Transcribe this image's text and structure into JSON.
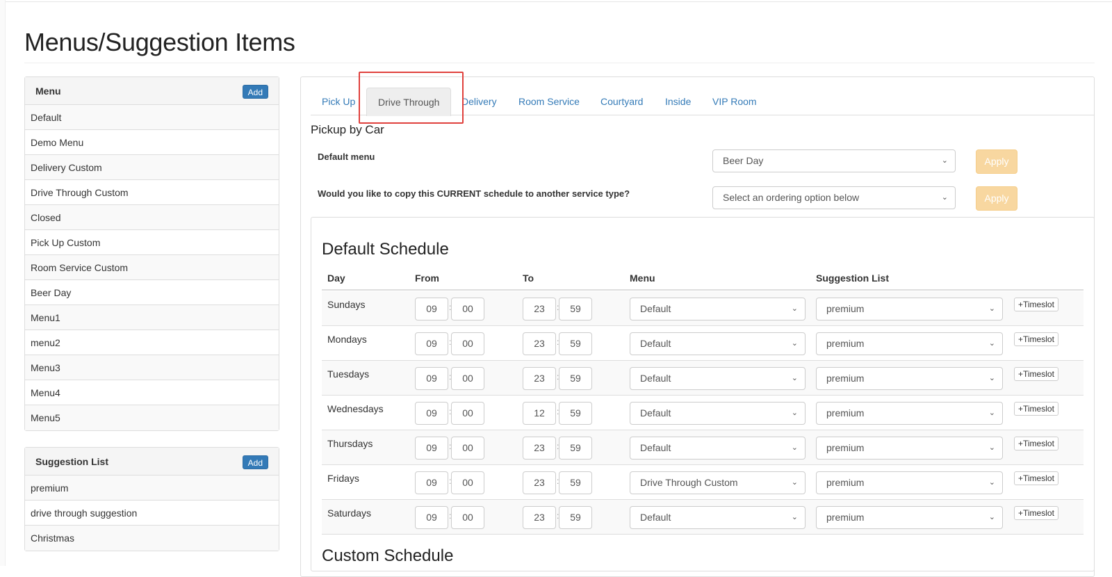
{
  "page": {
    "title": "Menus/Suggestion Items"
  },
  "menu_panel": {
    "title": "Menu",
    "add_label": "Add",
    "items": [
      "Default",
      "Demo Menu",
      "Delivery Custom",
      "Drive Through Custom",
      "Closed",
      "Pick Up Custom",
      "Room Service Custom",
      "Beer Day",
      "Menu1",
      "menu2",
      "Menu3",
      "Menu4",
      "Menu5"
    ]
  },
  "suggestion_panel": {
    "title": "Suggestion List",
    "add_label": "Add",
    "items": [
      "premium",
      "drive through suggestion",
      "Christmas"
    ]
  },
  "tabs": [
    "Pick Up",
    "Drive Through",
    "Delivery",
    "Room Service",
    "Courtyard",
    "Inside",
    "VIP Room"
  ],
  "active_tab": "Drive Through",
  "service": {
    "title": "Pickup by Car",
    "default_menu_label": "Default menu",
    "default_menu_value": "Beer Day",
    "copy_label": "Would you like to copy this CURRENT schedule to another service type?",
    "copy_placeholder": "Select an ordering option below",
    "apply_label": "Apply"
  },
  "schedule": {
    "title": "Default Schedule",
    "custom_title": "Custom Schedule",
    "headers": {
      "day": "Day",
      "from": "From",
      "to": "To",
      "menu": "Menu",
      "suggestion": "Suggestion List"
    },
    "timeslot_label": "+Timeslot",
    "rows": [
      {
        "day": "Sundays",
        "from_h": "09",
        "from_m": "00",
        "to_h": "23",
        "to_m": "59",
        "menu": "Default",
        "suggestion": "premium"
      },
      {
        "day": "Mondays",
        "from_h": "09",
        "from_m": "00",
        "to_h": "23",
        "to_m": "59",
        "menu": "Default",
        "suggestion": "premium"
      },
      {
        "day": "Tuesdays",
        "from_h": "09",
        "from_m": "00",
        "to_h": "23",
        "to_m": "59",
        "menu": "Default",
        "suggestion": "premium"
      },
      {
        "day": "Wednesdays",
        "from_h": "09",
        "from_m": "00",
        "to_h": "12",
        "to_m": "59",
        "menu": "Default",
        "suggestion": "premium"
      },
      {
        "day": "Thursdays",
        "from_h": "09",
        "from_m": "00",
        "to_h": "23",
        "to_m": "59",
        "menu": "Default",
        "suggestion": "premium"
      },
      {
        "day": "Fridays",
        "from_h": "09",
        "from_m": "00",
        "to_h": "23",
        "to_m": "59",
        "menu": "Drive Through Custom",
        "suggestion": "premium"
      },
      {
        "day": "Saturdays",
        "from_h": "09",
        "from_m": "00",
        "to_h": "23",
        "to_m": "59",
        "menu": "Default",
        "suggestion": "premium"
      }
    ]
  },
  "colors": {
    "link": "#337ab7",
    "apply_button": "#f8d7a0",
    "highlight": "#e0403c"
  }
}
